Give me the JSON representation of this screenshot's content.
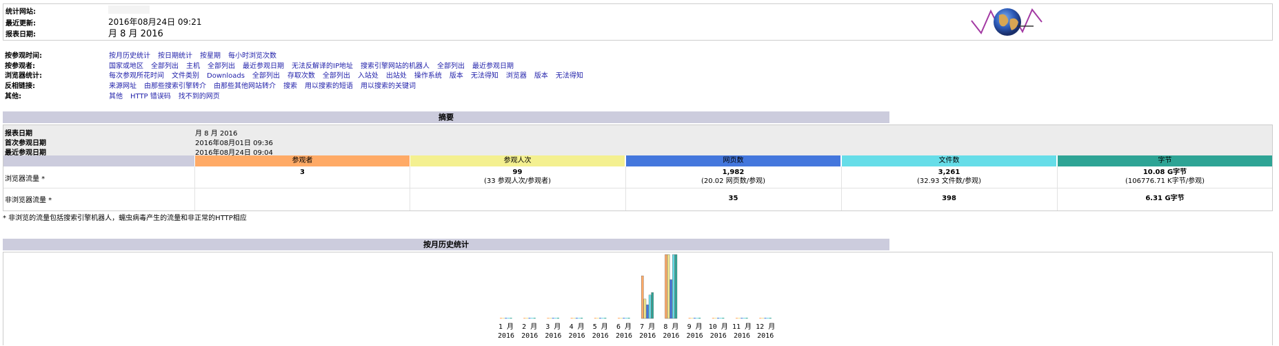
{
  "header": {
    "labels": {
      "site": "统计网站:",
      "updated": "最近更新:",
      "report": "报表日期:"
    },
    "values": {
      "site": "",
      "updated": "2016年08月24日 09:21",
      "report": "月 8 月 2016"
    }
  },
  "nav": {
    "rows": [
      {
        "label": "按参观时间:",
        "links": [
          "按月历史统计",
          "按日期统计",
          "按星期",
          "每小时浏览次数"
        ]
      },
      {
        "label": "按参观者:",
        "links": [
          "国家或地区",
          "全部列出",
          "主机",
          "全部列出",
          "最近参观日期",
          "无法反解译的IP地址",
          "搜索引擎网站的机器人",
          "全部列出",
          "最近参观日期"
        ]
      },
      {
        "label": "浏览器统计:",
        "links": [
          "每次参观所花时间",
          "文件类别",
          "Downloads",
          "全部列出",
          "存取次数",
          "全部列出",
          "入站处",
          "出站处",
          "操作系统",
          "版本",
          "无法得知",
          "浏览器",
          "版本",
          "无法得知"
        ]
      },
      {
        "label": "反相链接:",
        "links": [
          "来源网址",
          "由那些搜索引擎转介",
          "由那些其他网站转介",
          "搜索",
          "用以搜索的短语",
          "用以搜索的关键词"
        ]
      },
      {
        "label": "其他:",
        "links": [
          "其他",
          "HTTP 错误码",
          "找不到的网页"
        ]
      }
    ]
  },
  "summary": {
    "title": "摘要",
    "date_labels": [
      "报表日期",
      "首次参观日期",
      "最近参观日期"
    ],
    "date_values": [
      "月 8 月 2016",
      "2016年08月01日 09:36",
      "2016年08月24日 09:04"
    ],
    "columns": [
      {
        "label": "参观者",
        "color": "#ffaa66"
      },
      {
        "label": "参观人次",
        "color": "#f4f090"
      },
      {
        "label": "网页数",
        "color": "#4477dd"
      },
      {
        "label": "文件数",
        "color": "#66dde8"
      },
      {
        "label": "字节",
        "color": "#2ea495"
      }
    ],
    "rows": [
      {
        "label": "浏览器流量 *",
        "cells": [
          {
            "main": "3",
            "sub": ""
          },
          {
            "main": "99",
            "sub": "(33 参观人次/参观者)"
          },
          {
            "main": "1,982",
            "sub": "(20.02 网页数/参观)"
          },
          {
            "main": "3,261",
            "sub": "(32.93 文件数/参观)"
          },
          {
            "main": "10.08 G字节",
            "sub": "(106776.71 K字节/参观)"
          }
        ]
      },
      {
        "label": "非浏览器流量 *",
        "cells": [
          {
            "main": "",
            "sub": ""
          },
          {
            "main": "",
            "sub": ""
          },
          {
            "main": "35",
            "sub": ""
          },
          {
            "main": "398",
            "sub": ""
          },
          {
            "main": "6.31 G字节",
            "sub": ""
          }
        ]
      }
    ],
    "footnote": "* 非浏览的流量包括搜索引擎机器人，蠕虫病毒产生的流量和非正常的HTTP相应"
  },
  "monthly": {
    "title": "按月历史统计"
  },
  "chart_data": {
    "type": "bar",
    "categories": [
      "1 月\n2016",
      "2 月\n2016",
      "3 月\n2016",
      "4 月\n2016",
      "5 月\n2016",
      "6 月\n2016",
      "7 月\n2016",
      "8 月\n2016",
      "9 月\n2016",
      "10 月\n2016",
      "11 月\n2016",
      "12 月\n2016"
    ],
    "series": [
      {
        "key": "visitors",
        "color": "#ffaa66",
        "values": [
          0,
          0,
          0,
          0,
          0,
          0,
          2,
          3,
          0,
          0,
          0,
          0
        ]
      },
      {
        "key": "visits",
        "color": "#f0e68c",
        "values": [
          0,
          0,
          0,
          0,
          0,
          0,
          30,
          99,
          0,
          0,
          0,
          0
        ]
      },
      {
        "key": "pages",
        "color": "#4477dd",
        "values": [
          0,
          0,
          0,
          0,
          0,
          0,
          700,
          1982,
          0,
          0,
          0,
          0
        ]
      },
      {
        "key": "hits",
        "color": "#66dde8",
        "values": [
          0,
          0,
          0,
          0,
          0,
          0,
          1200,
          3261,
          0,
          0,
          0,
          0
        ]
      },
      {
        "key": "bandwidth",
        "color": "#2ea495",
        "values": [
          0,
          0,
          0,
          0,
          0,
          0,
          4.1,
          10.08,
          0,
          0,
          0,
          0
        ]
      }
    ],
    "ymax_per_series": {
      "visitors": 3,
      "visits": 99,
      "pages": 3261,
      "hits": 3261,
      "bandwidth": 10.08
    }
  }
}
